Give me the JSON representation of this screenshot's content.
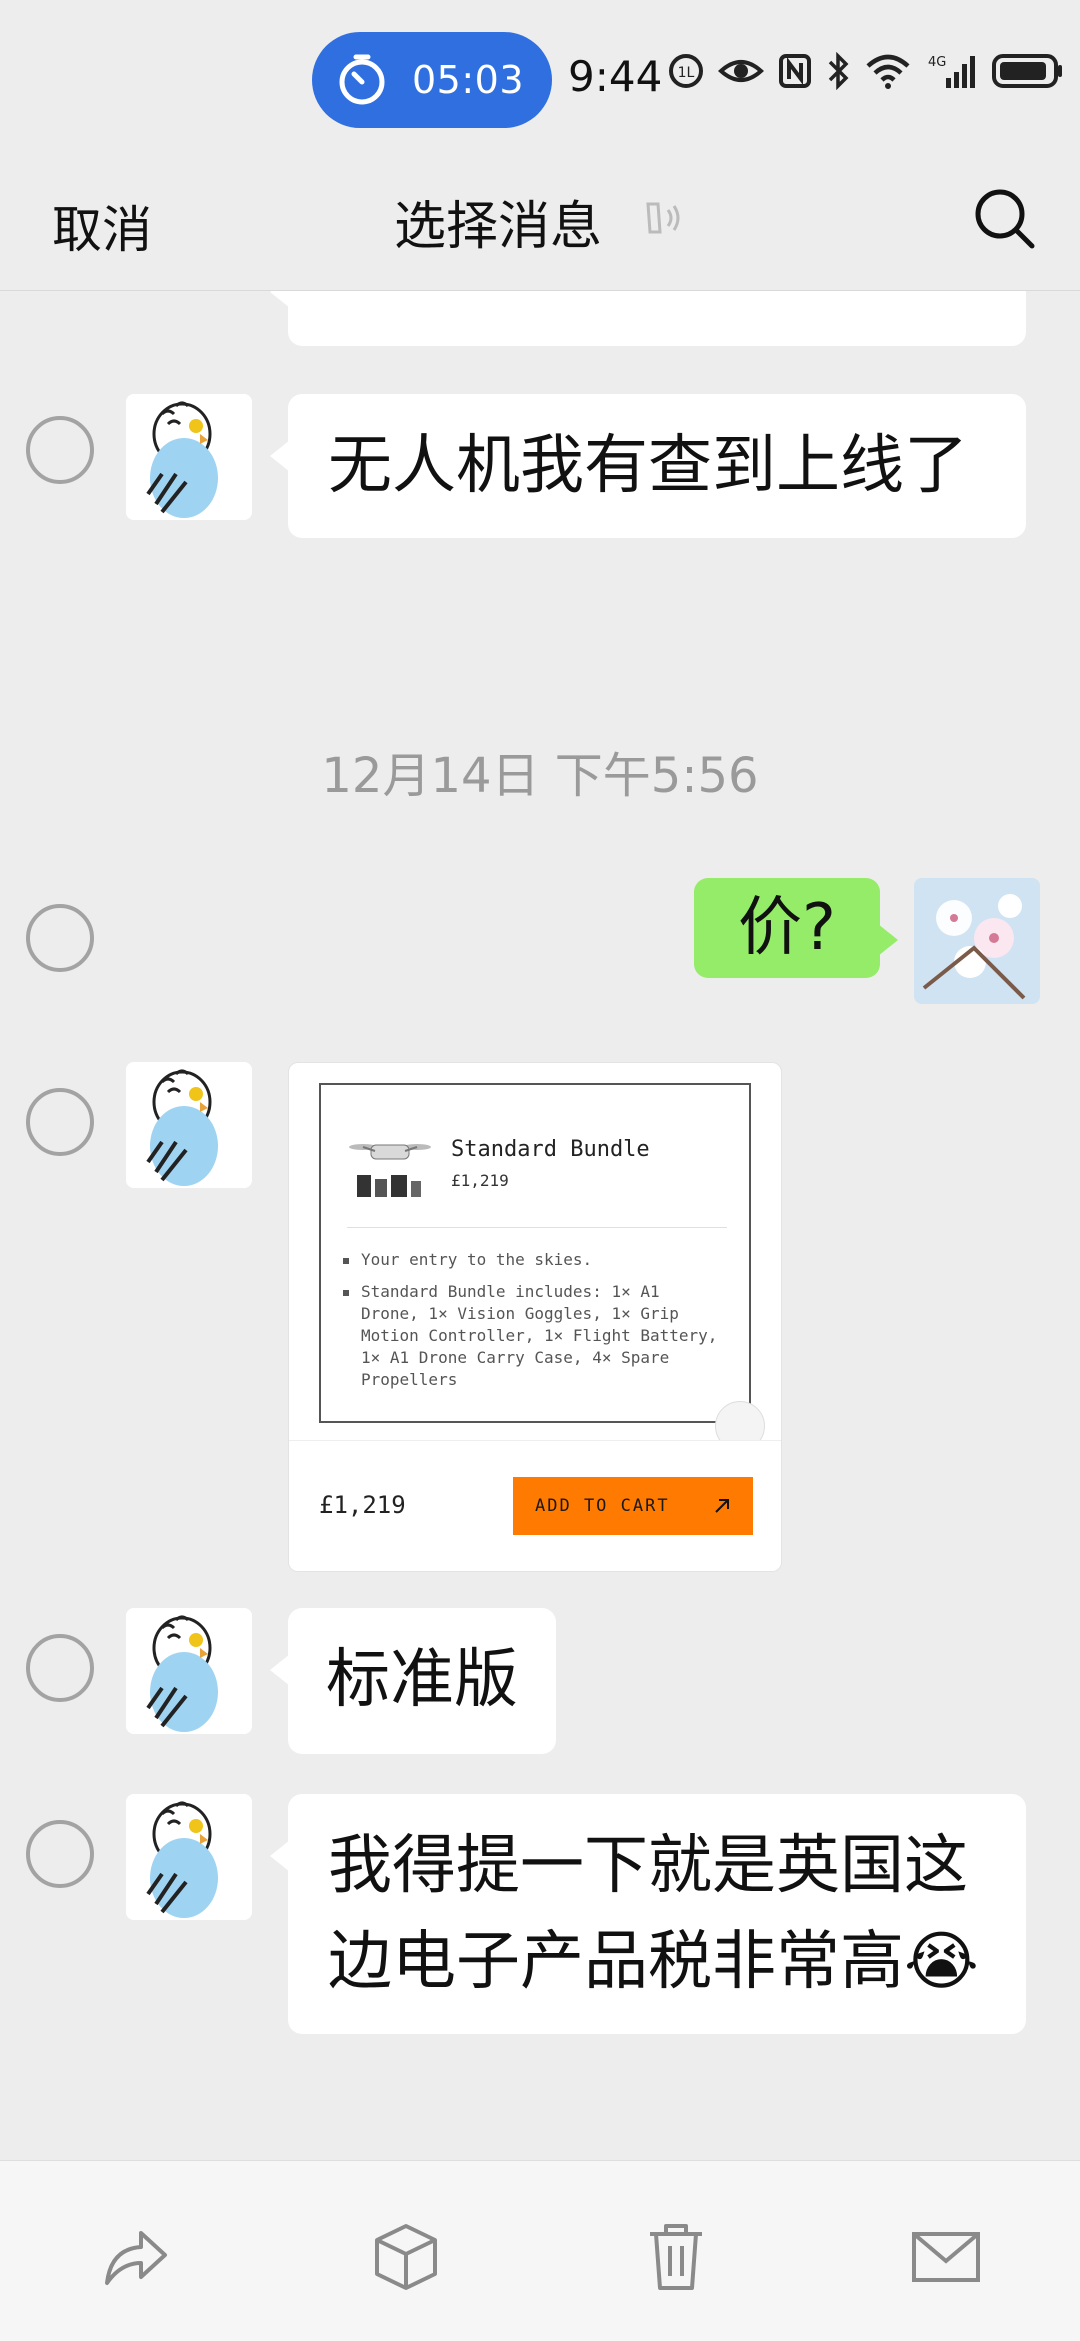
{
  "status_bar": {
    "timer": "05:03",
    "time": "9:44",
    "network": "4G",
    "accent": "#2f6fe0"
  },
  "header": {
    "cancel": "取消",
    "title": "选择消息"
  },
  "messages": [
    {
      "text": "无人机我有查到上线了"
    },
    {
      "timestamp": "12月14日 下午5:56"
    },
    {
      "text": "价?"
    },
    {
      "card": {
        "title": "Standard Bundle",
        "price": "£1,219",
        "bullet1": "Your entry to the skies.",
        "bullet2": "Standard Bundle includes: 1× A1 Drone, 1× Vision Goggles, 1× Grip Motion Controller, 1× Flight Battery, 1× A1 Drone Carry Case, 4× Spare Propellers",
        "footer_price": "£1,219",
        "cta": "ADD TO CART",
        "cta_color": "#ff7a00"
      }
    },
    {
      "text": "标准版"
    },
    {
      "text": "我得提一下就是英国这边电子产品税非常高😭"
    }
  ],
  "toolbar": [
    "forward-icon",
    "favorite-icon",
    "delete-icon",
    "email-icon"
  ]
}
